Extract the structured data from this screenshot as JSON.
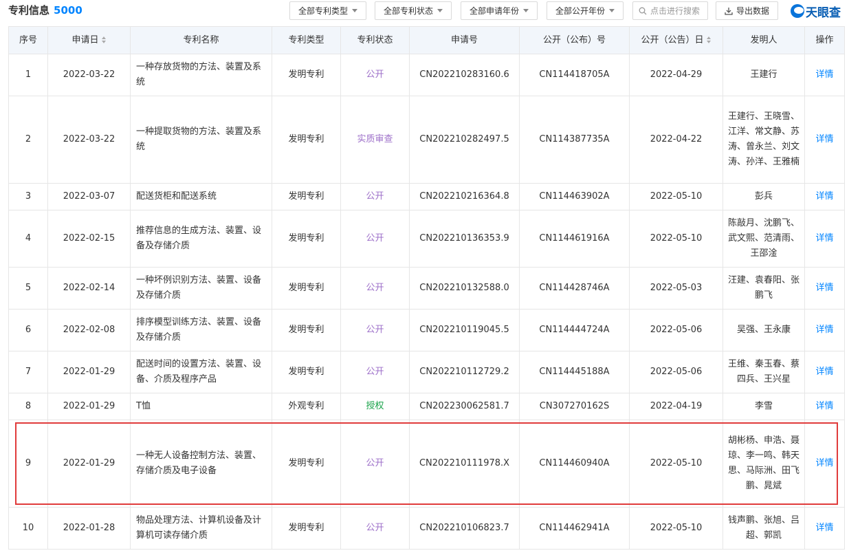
{
  "header": {
    "title": "专利信息",
    "count": "5000",
    "filters": [
      "全部专利类型",
      "全部专利状态",
      "全部申请年份",
      "全部公开年份"
    ],
    "search_placeholder": "点击进行搜索",
    "export_label": "导出数据",
    "logo_text": "天眼查"
  },
  "table": {
    "columns": [
      "序号",
      "申请日",
      "专利名称",
      "专利类型",
      "专利状态",
      "申请号",
      "公开（公布）号",
      "公开（公告）日",
      "发明人",
      "操作"
    ],
    "rows": [
      {
        "index": "1",
        "apply_date": "2022-03-22",
        "name": "一种存放货物的方法、装置及系统",
        "type": "发明专利",
        "status": "公开",
        "apply_no": "CN202210283160.6",
        "pub_no": "CN114418705A",
        "pub_date": "2022-04-29",
        "inventors": "王建行",
        "action": "详情"
      },
      {
        "index": "2",
        "apply_date": "2022-03-22",
        "name": "一种提取货物的方法、装置及系统",
        "type": "发明专利",
        "status": "实质审查",
        "apply_no": "CN202210282497.5",
        "pub_no": "CN114387735A",
        "pub_date": "2022-04-22",
        "inventors": "王建行、王晓雪、江洋、常文静、苏涛、曾永兰、刘文涛、孙洋、王雅楠",
        "action": "详情"
      },
      {
        "index": "3",
        "apply_date": "2022-03-07",
        "name": "配送货柜和配送系统",
        "type": "发明专利",
        "status": "公开",
        "apply_no": "CN202210216364.8",
        "pub_no": "CN114463902A",
        "pub_date": "2022-05-10",
        "inventors": "彭兵",
        "action": "详情"
      },
      {
        "index": "4",
        "apply_date": "2022-02-15",
        "name": "推荐信息的生成方法、装置、设备及存储介质",
        "type": "发明专利",
        "status": "公开",
        "apply_no": "CN202210136353.9",
        "pub_no": "CN114461916A",
        "pub_date": "2022-05-10",
        "inventors": "陈敲月、沈鹏飞、武文熙、范清雨、王邵淦",
        "action": "详情"
      },
      {
        "index": "5",
        "apply_date": "2022-02-14",
        "name": "一种坏例识别方法、装置、设备及存储介质",
        "type": "发明专利",
        "status": "公开",
        "apply_no": "CN202210132588.0",
        "pub_no": "CN114428746A",
        "pub_date": "2022-05-03",
        "inventors": "汪建、袁春阳、张鹏飞",
        "action": "详情"
      },
      {
        "index": "6",
        "apply_date": "2022-02-08",
        "name": "排序模型训练方法、装置、设备及存储介质",
        "type": "发明专利",
        "status": "公开",
        "apply_no": "CN202210119045.5",
        "pub_no": "CN114444724A",
        "pub_date": "2022-05-06",
        "inventors": "吴强、王永康",
        "action": "详情"
      },
      {
        "index": "7",
        "apply_date": "2022-01-29",
        "name": "配送时间的设置方法、装置、设备、介质及程序产品",
        "type": "发明专利",
        "status": "公开",
        "apply_no": "CN202210112729.2",
        "pub_no": "CN114445188A",
        "pub_date": "2022-05-06",
        "inventors": "王维、秦玉春、蔡四兵、王兴星",
        "action": "详情"
      },
      {
        "index": "8",
        "apply_date": "2022-01-29",
        "name": "T恤",
        "type": "外观专利",
        "status": "授权",
        "apply_no": "CN202230062581.7",
        "pub_no": "CN307270162S",
        "pub_date": "2022-04-19",
        "inventors": "李雪",
        "action": "详情"
      },
      {
        "index": "9",
        "apply_date": "2022-01-29",
        "name": "一种无人设备控制方法、装置、存储介质及电子设备",
        "type": "发明专利",
        "status": "公开",
        "apply_no": "CN202210111978.X",
        "pub_no": "CN114460940A",
        "pub_date": "2022-05-10",
        "inventors": "胡彬杨、申浩、聂琼、李一鸣、韩天思、马际洲、田飞鹏、晁斌",
        "action": "详情"
      },
      {
        "index": "10",
        "apply_date": "2022-01-28",
        "name": "物品处理方法、计算机设备及计算机可读存储介质",
        "type": "发明专利",
        "status": "公开",
        "apply_no": "CN202210106823.7",
        "pub_no": "CN114462941A",
        "pub_date": "2022-05-10",
        "inventors": "钱声鹏、张旭、吕超、郭凯",
        "action": "详情"
      }
    ]
  },
  "colors": {
    "accent": "#0084ff",
    "status_open": "#9d6fc9",
    "status_grant": "#1aa34a",
    "highlight_border": "#e03a3a",
    "header_bg": "#f2f6fb"
  }
}
